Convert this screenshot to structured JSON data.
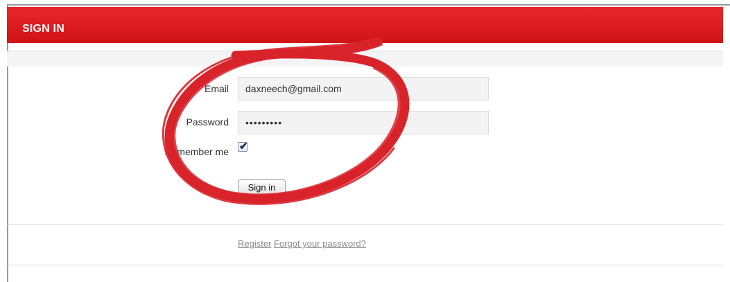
{
  "header": {
    "title": "SIGN IN",
    "color": "#d7191e"
  },
  "form": {
    "email_label": "Email",
    "email_value": "daxneech@gmail.com",
    "password_label": "Password",
    "password_value": "•••••••••",
    "remember_label": "Remember me",
    "remember_checked": true,
    "submit_label": "Sign in"
  },
  "footer": {
    "register_label": "Register",
    "forgot_label": "Forgot your password?"
  },
  "annotation": {
    "type": "hand-drawn-circle",
    "color": "#d8232a"
  }
}
